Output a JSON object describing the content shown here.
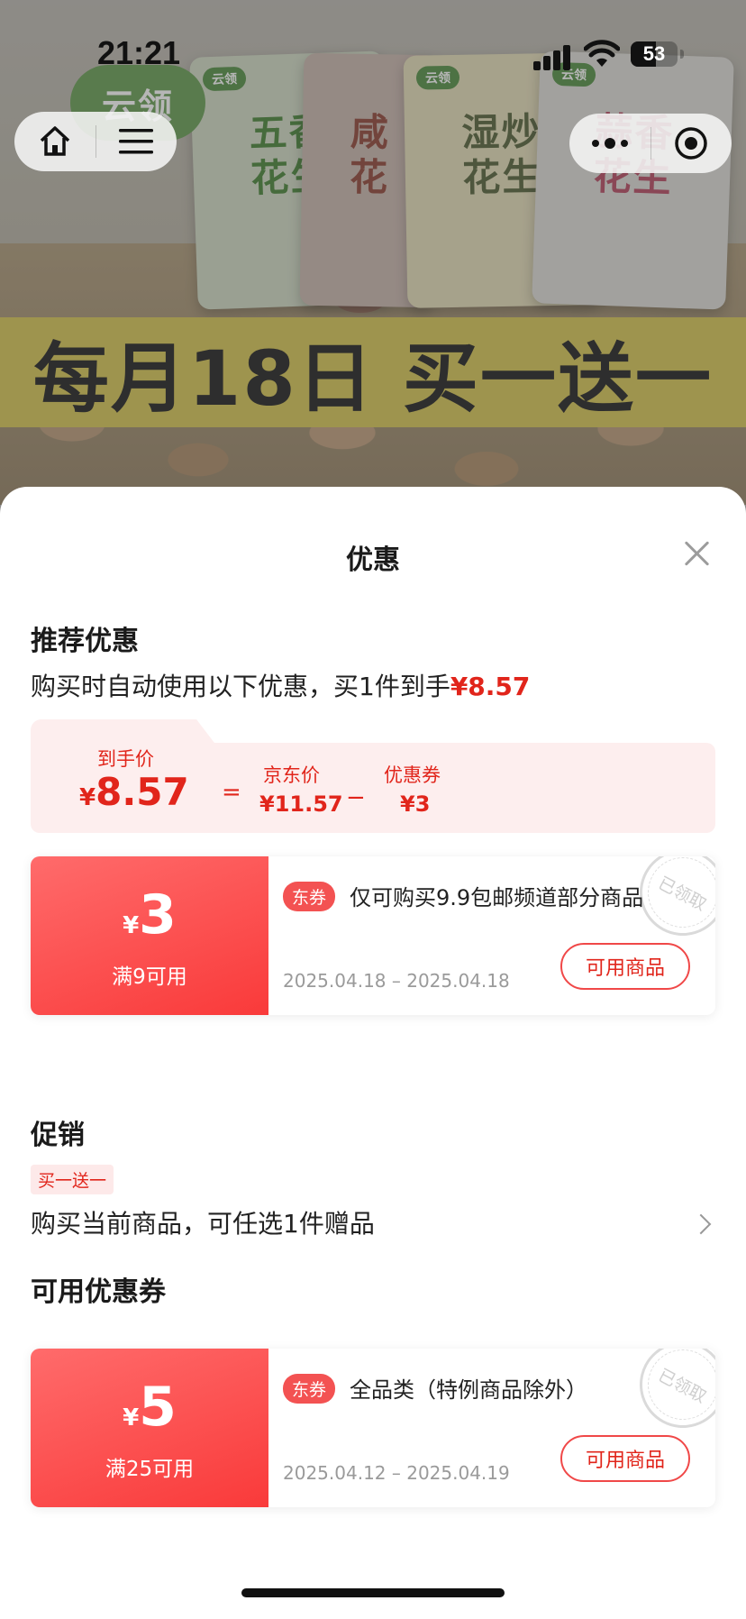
{
  "status_bar": {
    "time": "21:21",
    "battery": "53",
    "battery_level": 0.53
  },
  "banner": {
    "brand": "云领",
    "bags": [
      "五香\n花生",
      "咸\n花",
      "湿炒\n花生",
      "蒜香\n花生"
    ],
    "bag_logo": "云领",
    "promo_text": "每月18日 买一送一"
  },
  "sheet": {
    "title": "优惠",
    "recommended": {
      "heading": "推荐优惠",
      "desc_prefix": "购买时自动使用以下优惠，买1件到手",
      "desc_price": "¥8.57",
      "final_label": "到手价",
      "final_yen": "¥",
      "final_price": "8.57",
      "equals": "=",
      "jd_label": "京东价",
      "jd_price": "¥11.57",
      "minus": "−",
      "coupon_label": "优惠券",
      "coupon_price": "¥3"
    },
    "coupon1": {
      "yen": "¥",
      "amount": "3",
      "condition": "满9可用",
      "tag": "东券",
      "title": "仅可购买9.9包邮频道部分商品",
      "dates": "2025.04.18 – 2025.04.18",
      "button": "可用商品",
      "stamp": "已领取"
    },
    "promotion": {
      "heading": "促销",
      "tag": "买一送一",
      "desc": "购买当前商品，可任选1件赠品"
    },
    "available": {
      "heading": "可用优惠券"
    },
    "coupon2": {
      "yen": "¥",
      "amount": "5",
      "condition": "满25可用",
      "tag": "东券",
      "title": "全品类（特例商品除外）",
      "dates": "2025.04.12 – 2025.04.19",
      "button": "可用商品",
      "stamp": "已领取"
    }
  },
  "icons": [
    "home-icon",
    "menu-icon",
    "more-icon",
    "target-icon",
    "close-icon",
    "chevron-right-icon",
    "wifi-icon",
    "signal-icon",
    "battery-icon"
  ],
  "colors": {
    "accent": "#e1251b",
    "coupon_gradient_start": "#ff6b6b",
    "coupon_gradient_end": "#f93a3a",
    "breakdown_bg": "#fdeeee"
  }
}
